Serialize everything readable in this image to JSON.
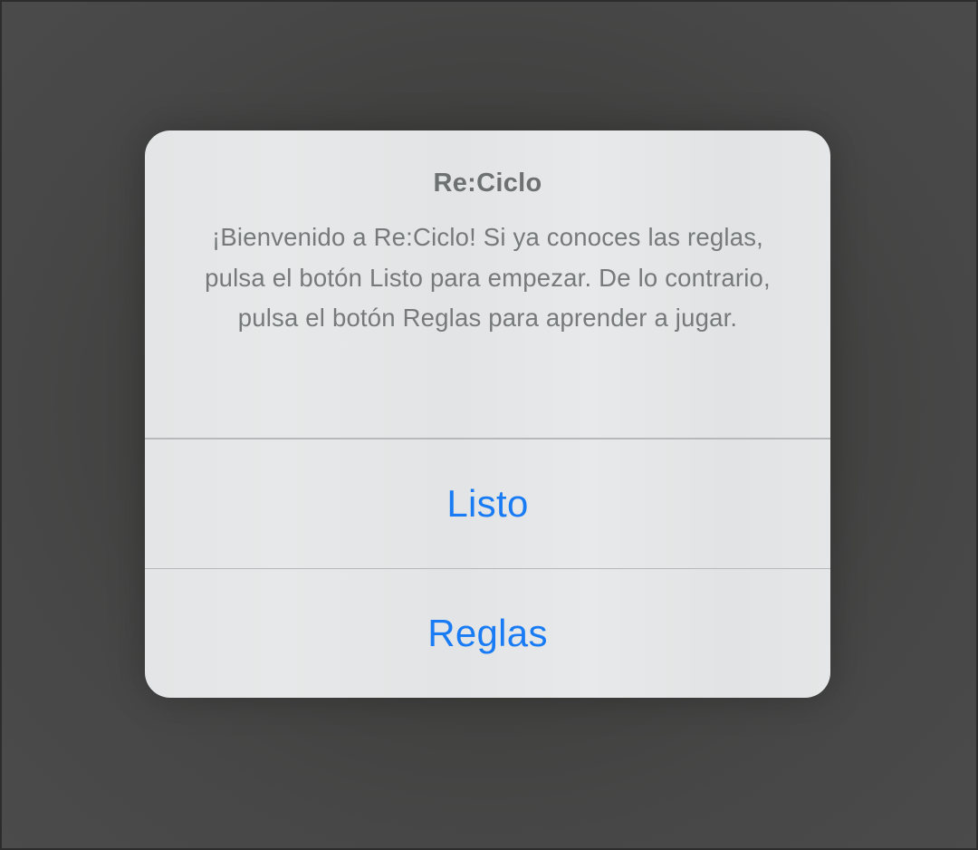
{
  "alert": {
    "title": "Re:Ciclo",
    "message": "¡Bienvenido a Re:Ciclo! Si ya conoces las reglas, pulsa el botón Listo para empezar. De lo contrario, pulsa el botón Reglas para aprender a jugar.",
    "buttons": [
      {
        "label": "Listo"
      },
      {
        "label": "Reglas"
      }
    ]
  },
  "colors": {
    "backdrop": "#4a4a4a",
    "alert_background": "#e4e6e7",
    "title_text": "#6d7172",
    "message_text": "#767a7b",
    "button_text": "#1a7cf5",
    "divider": "#b6b9ba"
  }
}
